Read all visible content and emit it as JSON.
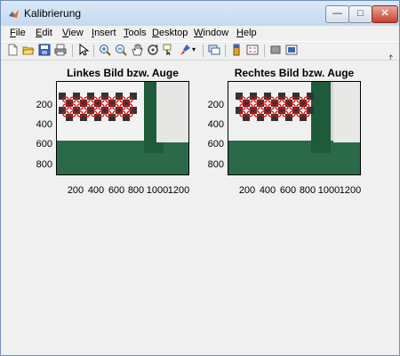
{
  "window": {
    "title": "Kalibrierung"
  },
  "menu": [
    {
      "key": "F",
      "rest": "ile"
    },
    {
      "key": "E",
      "rest": "dit"
    },
    {
      "key": "V",
      "rest": "iew"
    },
    {
      "key": "I",
      "rest": "nsert"
    },
    {
      "key": "T",
      "rest": "ools"
    },
    {
      "key": "D",
      "rest": "esktop"
    },
    {
      "key": "W",
      "rest": "indow"
    },
    {
      "key": "H",
      "rest": "elp"
    }
  ],
  "toolbar_icons": [
    "new-figure-icon",
    "open-file-icon",
    "save-icon",
    "print-icon",
    "edit-plot-icon",
    "zoom-in-icon",
    "zoom-out-icon",
    "pan-icon",
    "rotate-3d-icon",
    "data-cursor-icon",
    "brush-icon",
    "brush-dropdown-icon",
    "link-plot-icon",
    "insert-colorbar-icon",
    "insert-legend-icon",
    "hide-plot-tools-icon",
    "show-plot-tools-icon"
  ],
  "axes_left": {
    "title": "Linkes Bild bzw. Auge",
    "yticks": [
      "200",
      "400",
      "600",
      "800"
    ],
    "xticks": [
      "200",
      "400",
      "600",
      "800",
      "1000",
      "1200"
    ]
  },
  "axes_right": {
    "title": "Rechtes Bild bzw. Auge",
    "yticks": [
      "200",
      "400",
      "600",
      "800"
    ],
    "xticks": [
      "200",
      "400",
      "600",
      "800",
      "1000",
      "1200"
    ]
  },
  "colors": {
    "board_green": "#1f5a3a",
    "marker_red": "#e01010",
    "checker_dark": "#333333"
  }
}
